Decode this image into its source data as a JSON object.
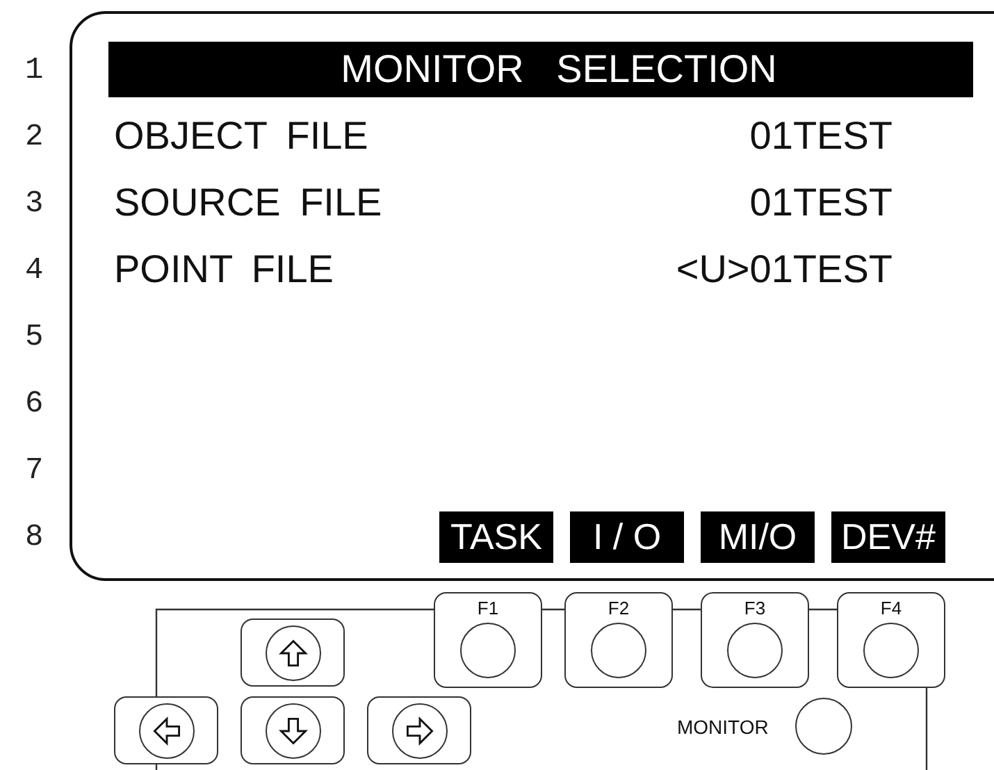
{
  "line_numbers": [
    "1",
    "2",
    "3",
    "4",
    "5",
    "6",
    "7",
    "8"
  ],
  "title": "MONITOR   SELECTION",
  "rows": [
    {
      "label": "OBJECT FILE",
      "value": "01TEST"
    },
    {
      "label": "SOURCE FILE",
      "value": "01TEST"
    },
    {
      "label": "POINT FILE",
      "value": "<U>01TEST"
    }
  ],
  "soft_keys": [
    "TASK",
    "I / O",
    "MI/O",
    "DEV#"
  ],
  "function_keys": [
    "F1",
    "F2",
    "F3",
    "F4"
  ],
  "monitor_button": {
    "label": "MONITOR"
  }
}
